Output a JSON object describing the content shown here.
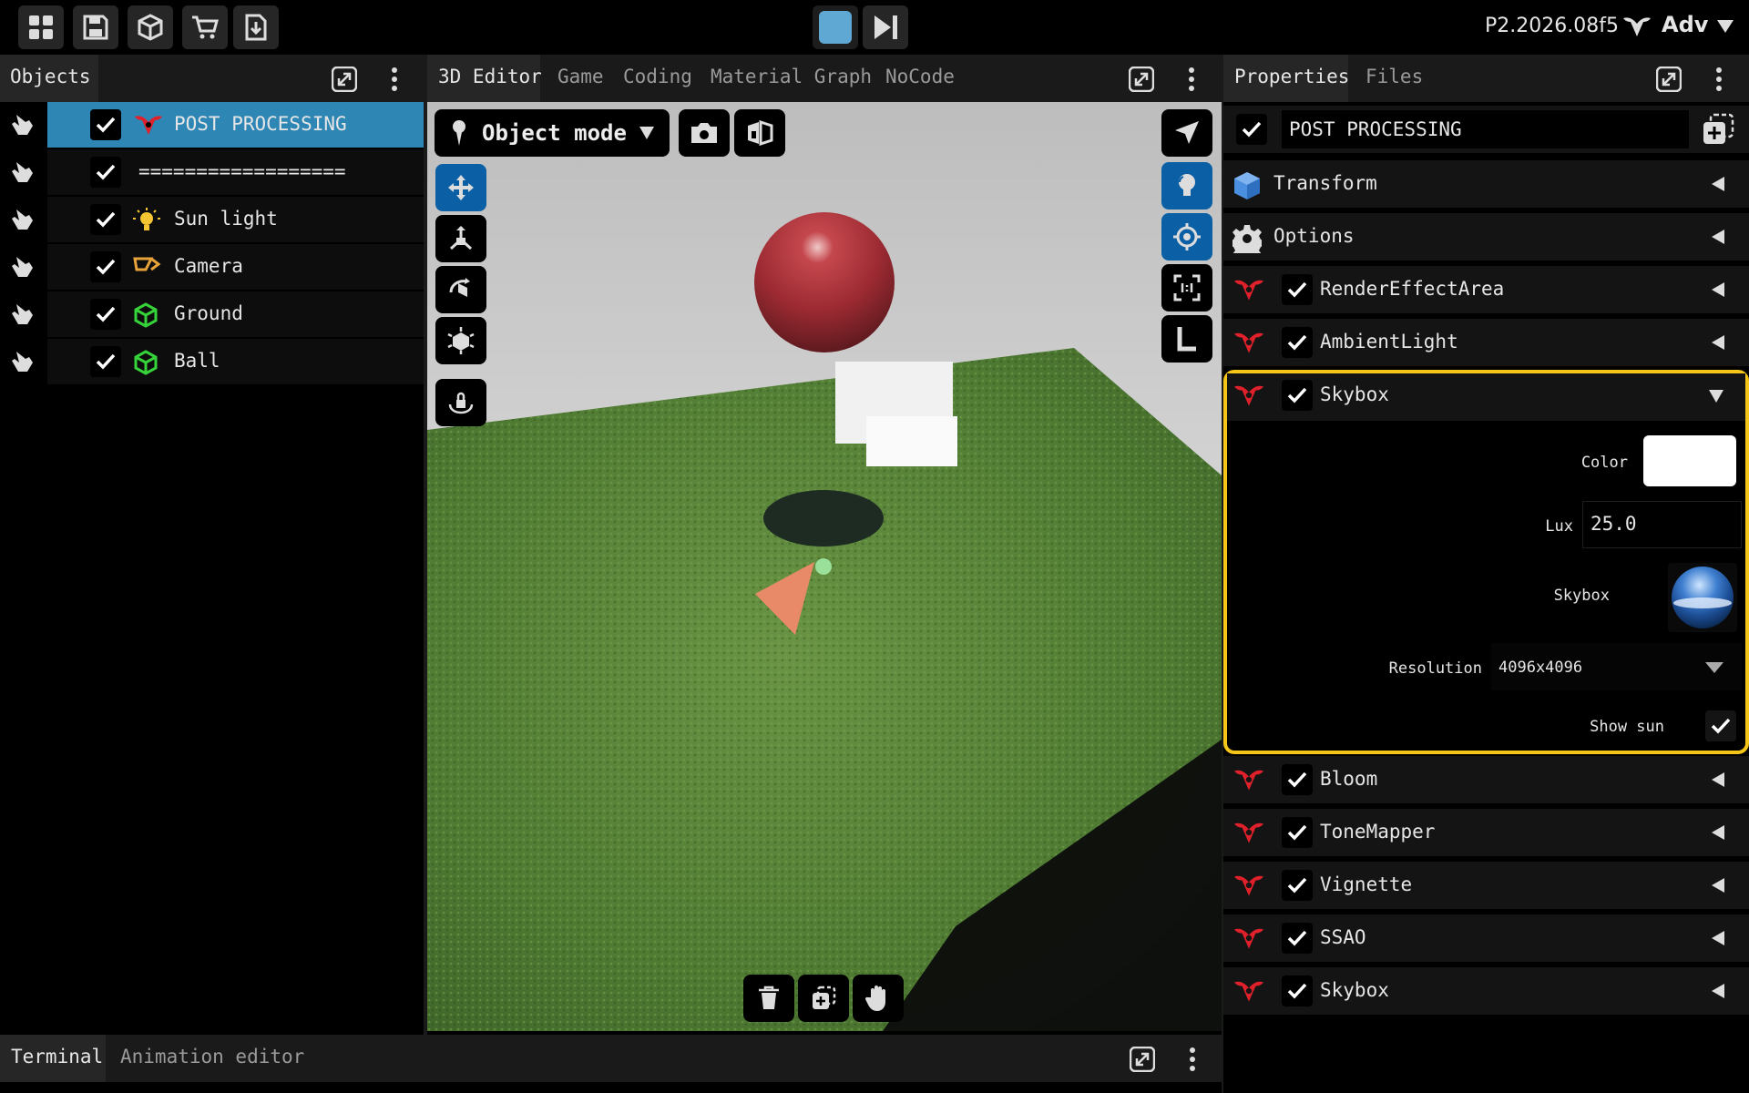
{
  "topbar": {
    "icons": [
      "grid-icon",
      "save-icon",
      "cube-icon",
      "cart-icon",
      "download-icon"
    ],
    "play_controls": [
      "stop-icon",
      "step-forward-icon"
    ],
    "version": "P2.2026.08f5",
    "mode_label": "Adv"
  },
  "objects_panel": {
    "tab": "Objects",
    "items": [
      {
        "label": "POST PROCESSING",
        "icon": "post-processing-icon",
        "selected": true
      },
      {
        "label": "==================",
        "icon": "",
        "selected": false
      },
      {
        "label": "Sun light",
        "icon": "bulb-icon",
        "selected": false
      },
      {
        "label": "Camera",
        "icon": "camera-icon",
        "selected": false
      },
      {
        "label": "Ground",
        "icon": "mesh-icon",
        "selected": false
      },
      {
        "label": "Ball",
        "icon": "mesh-icon",
        "selected": false
      }
    ]
  },
  "editor": {
    "tabs": [
      "3D Editor",
      "Game",
      "Coding",
      "Material Graph",
      "NoCode"
    ],
    "active_tab": "3D Editor",
    "mode": "Object mode"
  },
  "properties_panel": {
    "tabs": [
      "Properties",
      "Files"
    ],
    "object_name": "POST PROCESSING",
    "sections": [
      {
        "label": "Transform",
        "icon": "cube-icon"
      },
      {
        "label": "Options",
        "icon": "gear-icon"
      },
      {
        "label": "RenderEffectArea",
        "icon": "post-processing-icon"
      },
      {
        "label": "AmbientLight",
        "icon": "post-processing-icon"
      }
    ],
    "skybox": {
      "label": "Skybox",
      "color_label": "Color",
      "color_value": "#ffffff",
      "lux_label": "Lux",
      "lux_value": "25.0",
      "skybox_label": "Skybox",
      "resolution_label": "Resolution",
      "resolution_value": "4096x4096",
      "show_sun_label": "Show sun",
      "show_sun": true
    },
    "sections_after": [
      {
        "label": "Bloom"
      },
      {
        "label": "ToneMapper"
      },
      {
        "label": "Vignette"
      },
      {
        "label": "SSAO"
      },
      {
        "label": "Skybox"
      }
    ]
  },
  "bottom_panel": {
    "tabs": [
      "Terminal",
      "Animation editor"
    ],
    "active_tab": "Terminal"
  },
  "colors": {
    "accent": "#2e86b5",
    "highlight": "#f5c518",
    "tool_active": "#0b5fa5",
    "post_processing": "#e0202a"
  }
}
